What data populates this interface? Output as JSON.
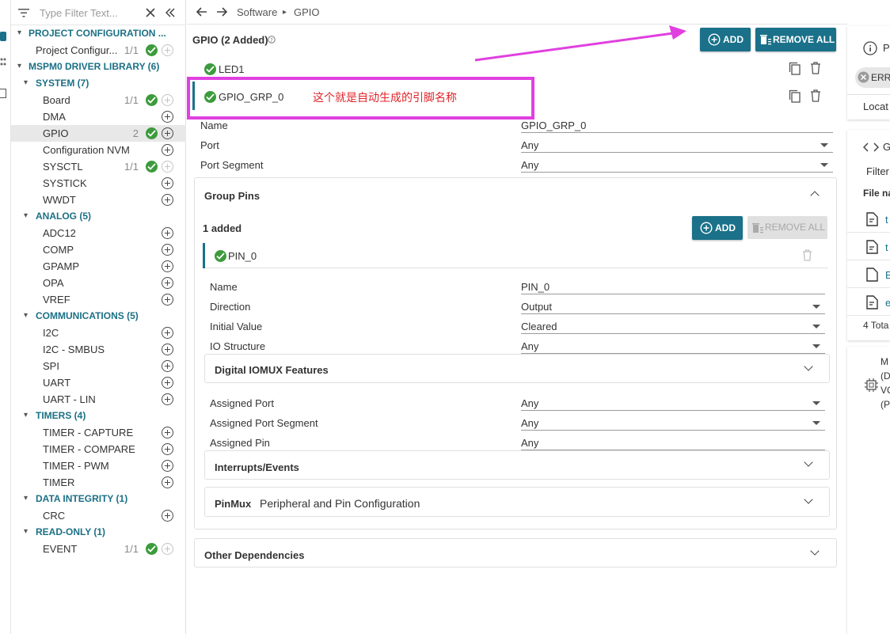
{
  "sidebar": {
    "filter_placeholder": "Type Filter Text...",
    "items": [
      {
        "label": "PROJECT CONFIGURATION ...",
        "type": "category"
      },
      {
        "label": "Project Configur...",
        "count": "1/1",
        "status": "ok"
      },
      {
        "label": "MSPM0 DRIVER LIBRARY (6)",
        "type": "category"
      },
      {
        "label": "SYSTEM (7)",
        "type": "category"
      },
      {
        "label": "Board",
        "count": "1/1",
        "status": "ok"
      },
      {
        "label": "DMA"
      },
      {
        "label": "GPIO",
        "count": "2",
        "status": "ok",
        "selected": true
      },
      {
        "label": "Configuration NVM"
      },
      {
        "label": "SYSCTL",
        "count": "1/1",
        "status": "ok"
      },
      {
        "label": "SYSTICK"
      },
      {
        "label": "WWDT"
      },
      {
        "label": "ANALOG (5)",
        "type": "category"
      },
      {
        "label": "ADC12"
      },
      {
        "label": "COMP"
      },
      {
        "label": "GPAMP"
      },
      {
        "label": "OPA"
      },
      {
        "label": "VREF"
      },
      {
        "label": "COMMUNICATIONS (5)",
        "type": "category"
      },
      {
        "label": "I2C"
      },
      {
        "label": "I2C - SMBUS"
      },
      {
        "label": "SPI"
      },
      {
        "label": "UART"
      },
      {
        "label": "UART - LIN"
      },
      {
        "label": "TIMERS (4)",
        "type": "category"
      },
      {
        "label": "TIMER - CAPTURE"
      },
      {
        "label": "TIMER - COMPARE"
      },
      {
        "label": "TIMER - PWM"
      },
      {
        "label": "TIMER"
      },
      {
        "label": "DATA INTEGRITY (1)",
        "type": "category"
      },
      {
        "label": "CRC"
      },
      {
        "label": "READ-ONLY (1)",
        "type": "category"
      },
      {
        "label": "EVENT",
        "count": "1/1",
        "status": "ok"
      }
    ]
  },
  "breadcrumb": {
    "parent": "Software",
    "current": "GPIO"
  },
  "header": {
    "title": "GPIO (2 Added)",
    "add_label": "ADD",
    "remove_all_label": "REMOVE ALL"
  },
  "instances": [
    {
      "name": "LED1"
    },
    {
      "name": "GPIO_GRP_0"
    }
  ],
  "annotation": {
    "text": "这个就是自动生成的引脚名称",
    "color": "#e040e0"
  },
  "group_fields": [
    {
      "label": "Name",
      "value": "GPIO_GRP_0"
    },
    {
      "label": "Port",
      "value": "Any"
    },
    {
      "label": "Port Segment",
      "value": "Any"
    }
  ],
  "group_pins": {
    "title": "Group Pins",
    "added_count": "1 added",
    "add_label": "ADD",
    "remove_all_label": "REMOVE ALL",
    "pin_name": "PIN_0",
    "fields": [
      {
        "label": "Name",
        "value": "PIN_0"
      },
      {
        "label": "Direction",
        "value": "Output"
      },
      {
        "label": "Initial Value",
        "value": "Cleared"
      },
      {
        "label": "IO Structure",
        "value": "Any"
      }
    ],
    "iomux_title": "Digital IOMUX Features",
    "iomux_fields": [
      {
        "label": "Assigned Port",
        "value": "Any"
      },
      {
        "label": "Assigned Port Segment",
        "value": "Any"
      },
      {
        "label": "Assigned Pin",
        "value": "Any"
      }
    ],
    "interrupts_title": "Interrupts/Events",
    "pinmux_title": "PinMux",
    "pinmux_subtitle": "Peripheral and Pin Configuration"
  },
  "other_dependencies": "Other Dependencies",
  "right_panel": {
    "problems_short": "P",
    "error_short": "ERR",
    "location_short": "Locat",
    "generated_short": "G",
    "filter_short": "Filter",
    "filename_short": "File na",
    "files": [
      "t",
      "t",
      "E",
      "e"
    ],
    "total_short": "4 Tota",
    "device_lines": [
      "M",
      "(D",
      "VC",
      "(P"
    ]
  },
  "colors": {
    "accent": "#1a7189",
    "ok": "#3c9b3c",
    "annotation": "#e040e0"
  }
}
